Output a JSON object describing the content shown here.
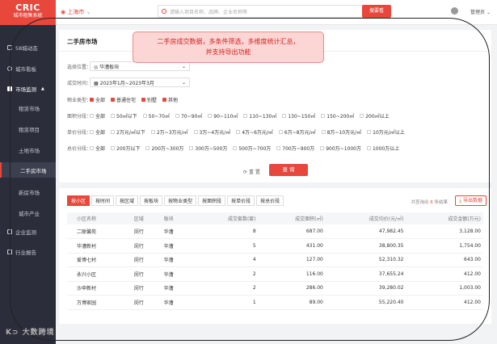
{
  "sidebar": {
    "brand_line1": "CRIC",
    "brand_line2": "城市租售系统",
    "items": [
      {
        "label": "58城动态"
      },
      {
        "label": "城市看板"
      },
      {
        "label": "市场监测"
      },
      {
        "label": "租赁市场"
      },
      {
        "label": "租赁项目"
      },
      {
        "label": "土地市场"
      },
      {
        "label": "二手房市场"
      },
      {
        "label": "新房市场"
      },
      {
        "label": "城市产业"
      },
      {
        "label": "企业监测"
      },
      {
        "label": "行业报告"
      }
    ]
  },
  "topbar": {
    "city": "上海市",
    "search_placeholder": "请输入项目名称、品牌、企业名称等",
    "search_button": "搜要看",
    "user": "管理员"
  },
  "filter": {
    "title": "二手房市场",
    "location_label": "选择位置：",
    "location_value": "华漕板块",
    "date_label": "成交时间：",
    "date_value": "2023年1月~2023年3月",
    "property_label": "物业类型：",
    "property_options": [
      "全部",
      "普通住宅",
      "别墅",
      "其他"
    ],
    "area_label": "面积分段：",
    "area_options": [
      "全部",
      "50㎡以下",
      "50~70㎡",
      "70~90㎡",
      "90~110㎡",
      "110~130㎡",
      "130~150㎡",
      "150~200㎡",
      "200㎡以上"
    ],
    "unitprice_label": "单价分段：",
    "unitprice_options": [
      "全部",
      "2万元/㎡以下",
      "2万~3万元/㎡",
      "3万~4万元/㎡",
      "4万~6万元/㎡",
      "6万~8万元/㎡",
      "8万~10万元/㎡",
      "10万元/㎡以上"
    ],
    "totalprice_label": "总价分段：",
    "totalprice_options": [
      "全部",
      "200万以下",
      "200万~300万",
      "300万~500万",
      "500万~700万",
      "700万~900万",
      "900万~1000万",
      "1000万以上"
    ],
    "reset_label": "重 置",
    "query_label": "查 询"
  },
  "results": {
    "tabs": [
      "按小区",
      "按时间",
      "按区域",
      "按板块",
      "按物业类型",
      "按面积段",
      "按单价段",
      "按总价段"
    ],
    "count_prefix": "共查询出",
    "count_value": "6",
    "count_suffix": "条结果",
    "export_label": "导出数据",
    "columns": [
      "小区名称",
      "区域",
      "板块",
      "成交套数(套)",
      "成交面积(㎡)",
      "成交均价(元/㎡)",
      "成交金额(万元)"
    ],
    "rows": [
      [
        "二联馨苑",
        "闵行",
        "华漕",
        "8",
        "687.00",
        "47,982.45",
        "3,128.00"
      ],
      [
        "华漕新村",
        "闵行",
        "华漕",
        "5",
        "431.00",
        "38,800.35",
        "1,754.00"
      ],
      [
        "爱博七村",
        "闵行",
        "华漕",
        "4",
        "127.00",
        "52,310.32",
        "643.00"
      ],
      [
        "永兴小区",
        "闵行",
        "华漕",
        "2",
        "116.00",
        "37,655.24",
        "412.00"
      ],
      [
        "沙申新村",
        "闵行",
        "华漕",
        "2",
        "286.00",
        "39,280.02",
        "1,003.00"
      ],
      [
        "万博家园",
        "闵行",
        "华漕",
        "1",
        "89.00",
        "55,220.40",
        "412.00"
      ]
    ]
  },
  "callout": {
    "line1": "二手房成交数据，多条件筛选，多维度统计汇总，",
    "line2": "并支持导出功能"
  },
  "watermark": "大数跨境",
  "colors": {
    "accent": "#e8473c",
    "sidebar": "#2b2e3a"
  }
}
